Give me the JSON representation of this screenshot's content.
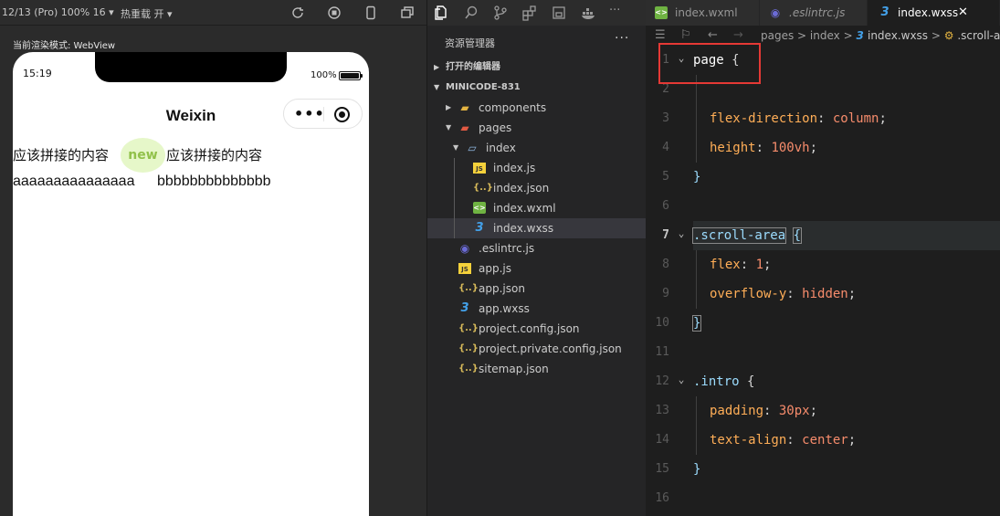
{
  "simulator": {
    "device_info": "12/13 (Pro) 100% 16 ▾",
    "hot_reload": "热重载 开 ▾",
    "render_mode": "当前渲染模式: WebView",
    "status_time": "15:19",
    "battery_pct": "100%",
    "battery_level": 1.0,
    "nav_title": "Weixin",
    "line1_left": "应该拼接的内容",
    "line1_badge": "new",
    "line1_right": "应该拼接的内容",
    "line2_a": "aaaaaaaaaaaaaaa",
    "line2_b": "bbbbbbbbbbbbbb",
    "badge_bg": "#e6f7c9",
    "badge_color": "#91c14a"
  },
  "explorer": {
    "title": "资源管理器",
    "more": "···",
    "open_editors": "打开的编辑器",
    "project": "MINICODE-831",
    "tree": [
      {
        "name": "components",
        "icon": "folder-icon"
      },
      {
        "name": "pages",
        "icon": "folder-red-icon"
      },
      {
        "name": "index",
        "icon": "folder-open-icon"
      },
      {
        "name": "index.js",
        "icon": "js-icon"
      },
      {
        "name": "index.json",
        "icon": "json-icon"
      },
      {
        "name": "index.wxml",
        "icon": "wxml-icon"
      },
      {
        "name": "index.wxss",
        "icon": "wxss-icon"
      },
      {
        "name": ".eslintrc.js",
        "icon": "eslint-icon"
      },
      {
        "name": "app.js",
        "icon": "js-icon"
      },
      {
        "name": "app.json",
        "icon": "json-icon"
      },
      {
        "name": "app.wxss",
        "icon": "wxss-icon"
      },
      {
        "name": "project.config.json",
        "icon": "json-icon"
      },
      {
        "name": "project.private.config.json",
        "icon": "json-icon"
      },
      {
        "name": "sitemap.json",
        "icon": "json-icon"
      }
    ],
    "selected": "index.wxss"
  },
  "editor": {
    "tabs": [
      {
        "label": "index.wxml",
        "icon": "wxml-icon",
        "active": false
      },
      {
        "label": ".eslintrc.js",
        "icon": "eslint-icon",
        "active": false
      },
      {
        "label": "index.wxss",
        "icon": "wxss-icon",
        "active": true
      }
    ],
    "close_glyph": "✕",
    "breadcrumb": {
      "part1": "pages",
      "sep": " > ",
      "part2": "index",
      "part3": "index.wxss",
      "part4": ".scroll-a"
    },
    "line_numbers": [
      "1",
      "2",
      "3",
      "4",
      "5",
      "6",
      "7",
      "8",
      "9",
      "10",
      "11",
      "12",
      "13",
      "14",
      "15",
      "16"
    ],
    "active_line": "7",
    "code": {
      "l1_sel": "page",
      "l1_brace": " {",
      "l3_prop": "flex-direction",
      "l3_val": "column",
      "l4_prop": "height",
      "l4_val": "100vh",
      "l5": "}",
      "l7_sel": ".scroll-area",
      "l7_brace": "{",
      "l8_prop": "flex",
      "l8_val": "1",
      "l9_prop": "overflow-y",
      "l9_val": "hidden",
      "l10": "}",
      "l12_sel": ".intro",
      "l12_brace": " {",
      "l13_prop": "padding",
      "l13_val": "30px",
      "l14_prop": "text-align",
      "l14_val": "center",
      "l15": "}",
      "colon": ": ",
      "semi": ";"
    },
    "annotation_color": "#e53935"
  }
}
